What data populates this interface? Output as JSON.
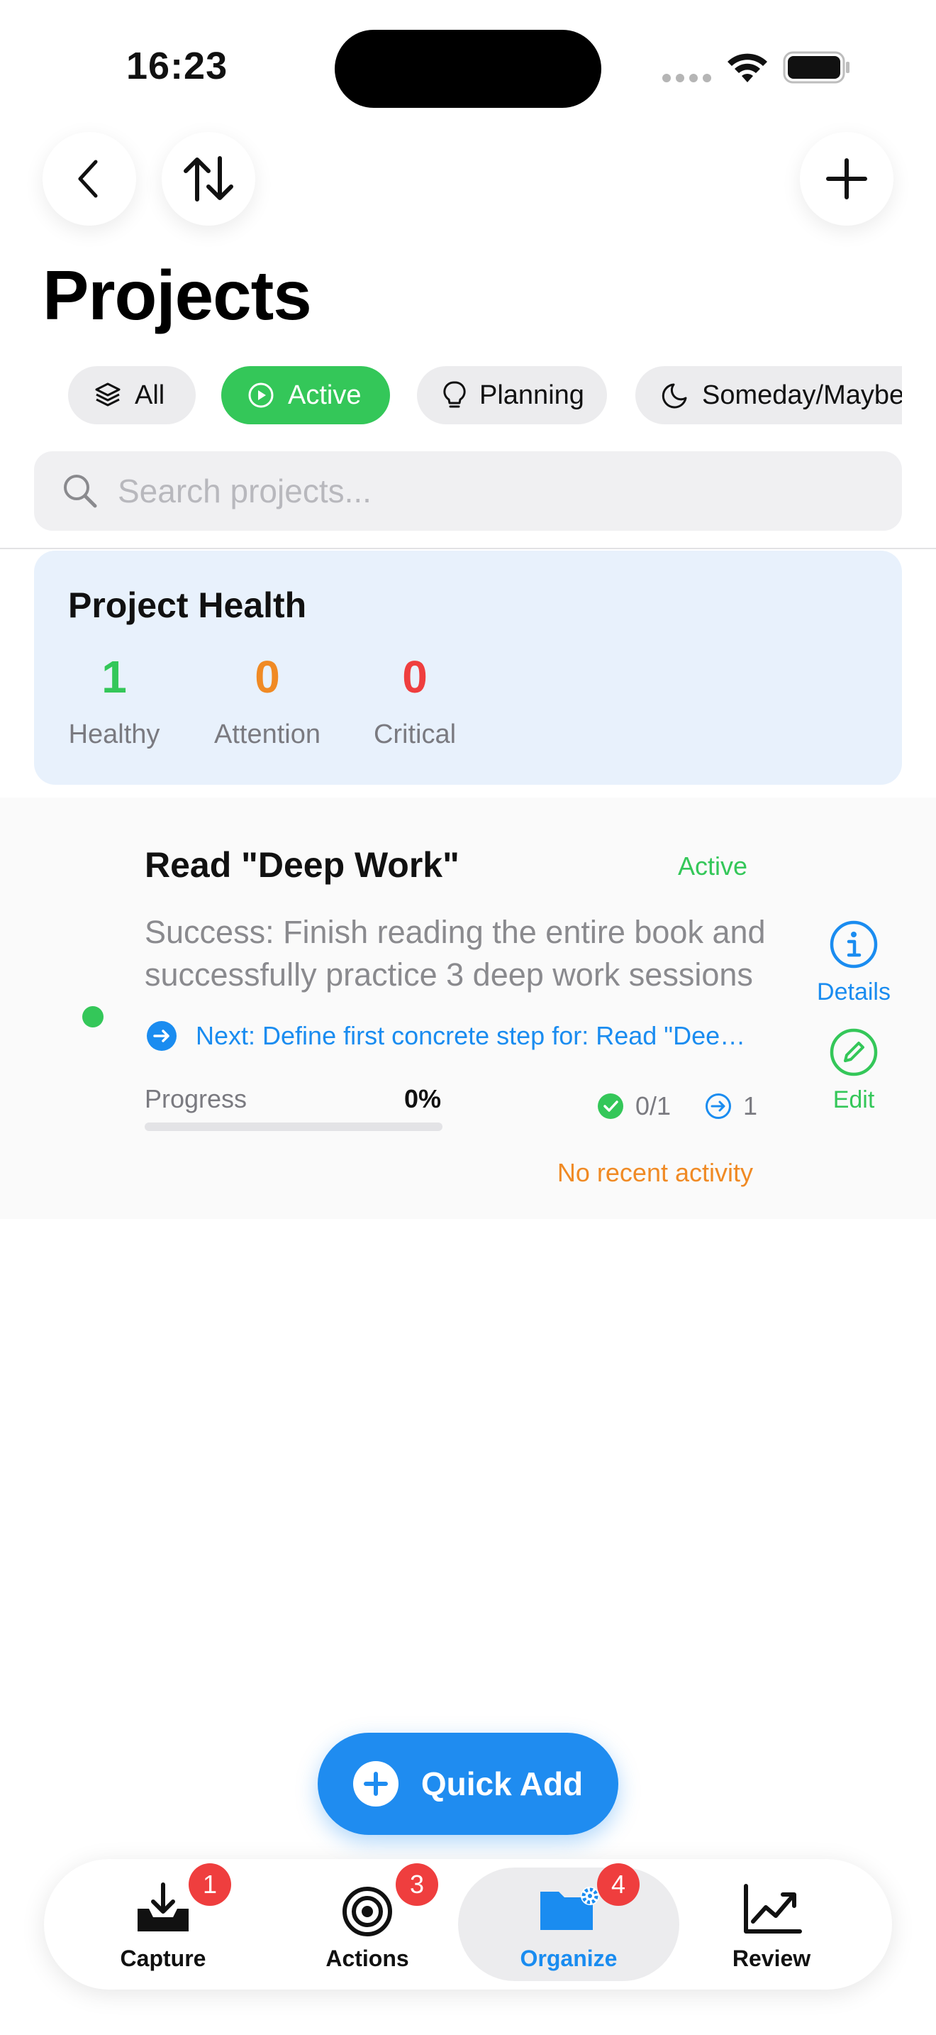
{
  "status_bar": {
    "time": "16:23"
  },
  "header": {
    "title": "Projects"
  },
  "filters": [
    {
      "label": "All",
      "icon": "layers-icon"
    },
    {
      "label": "Active",
      "icon": "play-circle-icon",
      "selected": true
    },
    {
      "label": "Planning",
      "icon": "lightbulb-icon"
    },
    {
      "label": "Someday/Maybe",
      "icon": "moon-icon"
    }
  ],
  "search": {
    "placeholder": "Search projects...",
    "value": ""
  },
  "health": {
    "title": "Project Health",
    "healthy": {
      "value": "1",
      "label": "Healthy",
      "color": "#34c759"
    },
    "attention": {
      "value": "0",
      "label": "Attention",
      "color": "#f08a24"
    },
    "critical": {
      "value": "0",
      "label": "Critical",
      "color": "#ef3e3e"
    }
  },
  "project": {
    "title": "Read \"Deep Work\"",
    "status": "Active",
    "description": "Success: Finish reading the entire book and successfully practice 3 deep work sessions",
    "next_action": "Next: Define first concrete step for: Read \"Deep Work\"",
    "progress_label": "Progress",
    "progress_text": "0%",
    "progress_fraction": 0,
    "actions_done": "0/1",
    "next_count": "1",
    "activity": "No recent activity",
    "details_label": "Details",
    "edit_label": "Edit"
  },
  "quick_add": {
    "label": "Quick Add"
  },
  "tabs": [
    {
      "label": "Capture",
      "badge": "1"
    },
    {
      "label": "Actions",
      "badge": "3"
    },
    {
      "label": "Organize",
      "badge": "4",
      "selected": true
    },
    {
      "label": "Review"
    }
  ],
  "colors": {
    "accent": "#1a8cf0",
    "active_green": "#34c759",
    "warning_orange": "#f08a24",
    "badge_red": "#ef3e3e",
    "health_card_bg": "#e8f1fc"
  }
}
